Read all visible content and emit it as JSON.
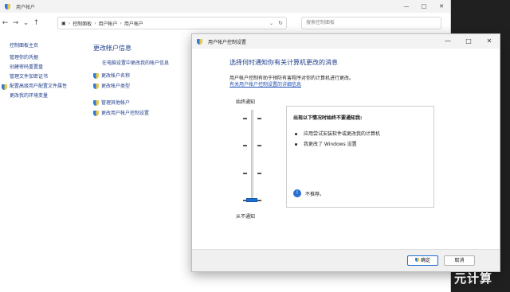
{
  "background_window": {
    "title": "用户帐户",
    "controls": [
      "—",
      "□",
      "✕"
    ],
    "address": {
      "crumbs": [
        "控制面板",
        "用户帐户",
        "用户帐户"
      ],
      "search_placeholder": "搜索控制面板"
    },
    "sidebar": {
      "home": "控制面板主页",
      "items": [
        "管理你的凭据",
        "创建密码重置盘",
        "管理文件加密证书",
        "配置高级用户配置文件属性",
        "更改我的环境变量"
      ]
    },
    "main": {
      "heading": "更改帐户信息",
      "settings_link": "在电脑设置中更改我的帐户信息",
      "links_group_1": [
        "更改帐户名称",
        "更改帐户类型"
      ],
      "links_group_2": [
        "管理其他帐户",
        "更改用户帐户控制设置"
      ]
    }
  },
  "dialog": {
    "title": "用户帐户控制设置",
    "controls": [
      "—",
      "□",
      "✕"
    ],
    "heading": "选择何时通知你有关计算机更改的消息",
    "description": "用户帐户控制有助于预防有害程序对你的计算机进行更改。",
    "more_link": "有关用户帐户控制设置的详细信息",
    "slider": {
      "top_label": "始终通知",
      "bottom_label": "从不通知",
      "level_fraction": 0.0
    },
    "info": {
      "title": "出现以下情况时始终不要通知我:",
      "bullets": [
        "应用尝试安装软件或更改我的计算机",
        "我更改了 Windows 设置"
      ],
      "note": "不推荐。"
    },
    "ok_label": "确定",
    "cancel_label": "取消"
  },
  "watermark": {
    "text": "元计算"
  },
  "colors": {
    "link": "#1f3d8a",
    "slider_thumb": "#1e6fd2",
    "dialog_bg": "#ffffff"
  }
}
